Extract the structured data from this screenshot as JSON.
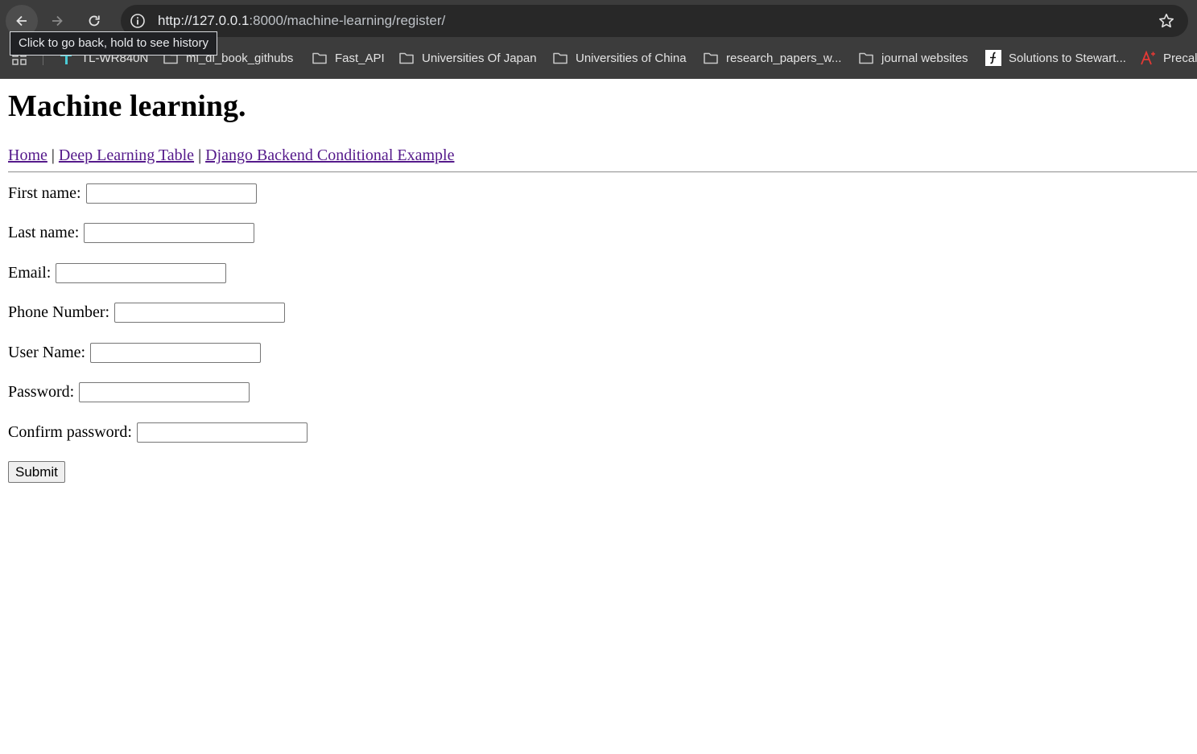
{
  "browser": {
    "url_host": "http://127.0.0.1",
    "url_rest": ":8000/machine-learning/register/",
    "tooltip": "Click to go back, hold to see history",
    "bookmarks": [
      {
        "label": "TL-WR840N",
        "icon": "tp-link-icon"
      },
      {
        "label": "ml_dl_book_githubs",
        "icon": "folder-icon"
      },
      {
        "label": "Fast_API",
        "icon": "folder-icon"
      },
      {
        "label": "Universities Of Japan",
        "icon": "folder-icon"
      },
      {
        "label": "Universities of China",
        "icon": "folder-icon"
      },
      {
        "label": "research_papers_w...",
        "icon": "folder-icon"
      },
      {
        "label": "journal websites",
        "icon": "folder-icon"
      },
      {
        "label": "Solutions to Stewart...",
        "icon": "integral-icon"
      },
      {
        "label": "Precalc",
        "icon": "calculus-icon"
      }
    ]
  },
  "page": {
    "title": "Machine learning.",
    "nav": {
      "home": "Home",
      "sep": " | ",
      "deep_learning": "Deep Learning Table",
      "django": "Django Backend Conditional Example"
    },
    "form": {
      "first_name_label": "First name:",
      "last_name_label": "Last name:",
      "email_label": "Email:",
      "phone_label": "Phone Number:",
      "username_label": "User Name:",
      "password_label": "Password:",
      "confirm_password_label": "Confirm password:",
      "submit_label": "Submit"
    }
  },
  "colors": {
    "chrome_bg": "#3c3c3c",
    "omnibox_bg": "#282828",
    "visited_link": "#551a8b"
  }
}
